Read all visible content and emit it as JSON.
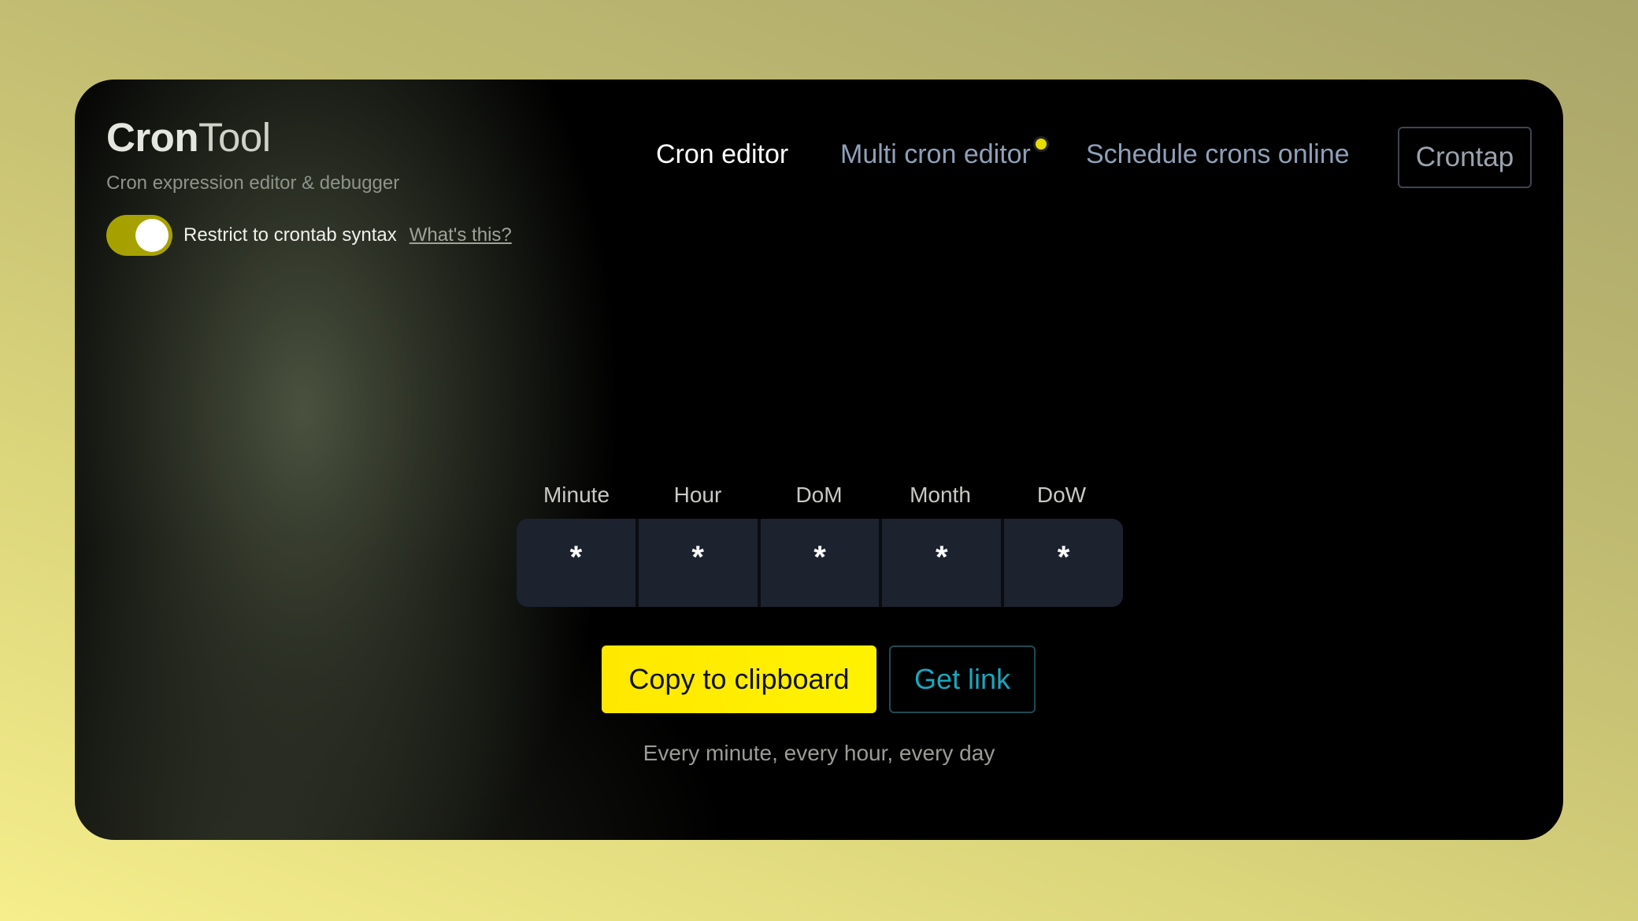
{
  "app": {
    "logo_bold": "Cron",
    "logo_regular": "Tool",
    "tagline": "Cron expression editor & debugger"
  },
  "toggle": {
    "label": "Restrict to crontab syntax",
    "help_link": "What's this?",
    "enabled": true,
    "accent_color": "#a7a100"
  },
  "nav": {
    "items": [
      {
        "label": "Cron editor",
        "active": true
      },
      {
        "label": "Multi cron editor",
        "badge_dot": true
      },
      {
        "label": "Schedule crons online"
      }
    ],
    "button": "Crontap"
  },
  "editor": {
    "fields": [
      {
        "label": "Minute",
        "value": "*"
      },
      {
        "label": "Hour",
        "value": "*"
      },
      {
        "label": "DoM",
        "value": "*"
      },
      {
        "label": "Month",
        "value": "*"
      },
      {
        "label": "DoW",
        "value": "*"
      }
    ]
  },
  "actions": {
    "copy": "Copy to clipboard",
    "link": "Get link"
  },
  "description": "Every minute, every hour, every day",
  "colors": {
    "primary_yellow": "#fff200",
    "link_teal": "#19a7bd",
    "field_bg": "#1c222e"
  }
}
